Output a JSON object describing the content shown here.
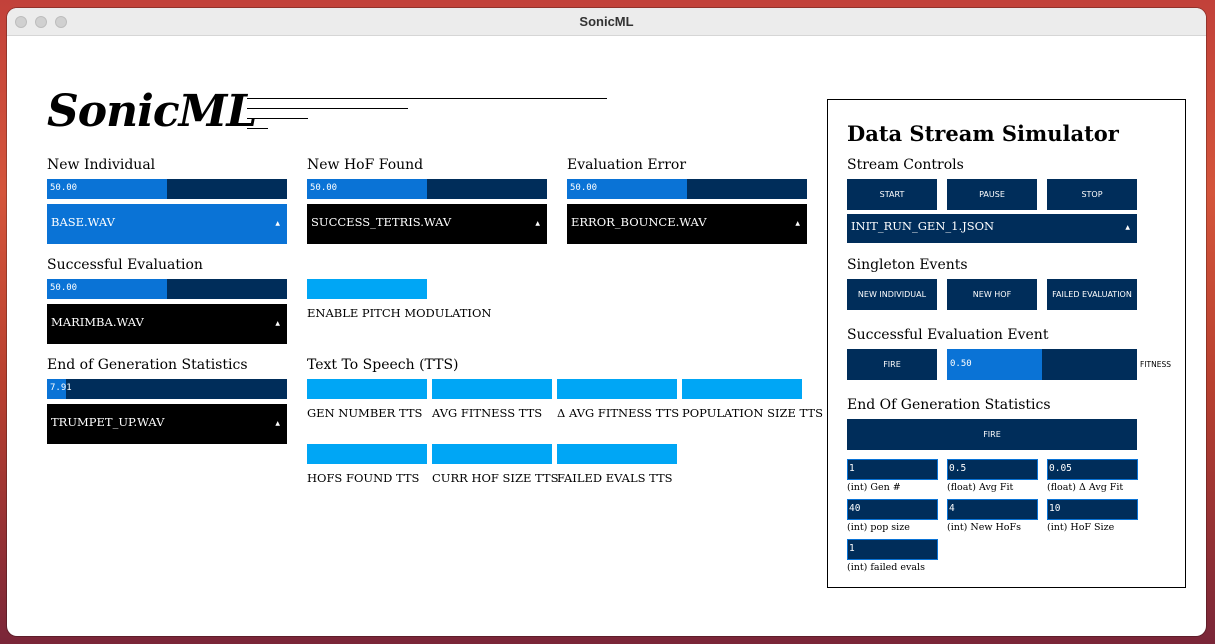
{
  "window": {
    "title": "SonicML"
  },
  "logo": "SonicML",
  "left": {
    "new_individual": {
      "label": "New Individual",
      "volume": "50.00",
      "volume_fraction": 0.5,
      "sound": "BASE.WAV"
    },
    "new_hof": {
      "label": "New HoF Found",
      "volume": "50.00",
      "volume_fraction": 0.5,
      "sound": "SUCCESS_TETRIS.WAV"
    },
    "eval_error": {
      "label": "Evaluation Error",
      "volume": "50.00",
      "volume_fraction": 0.5,
      "sound": "ERROR_BOUNCE.WAV"
    },
    "successful_eval": {
      "label": "Successful Evaluation",
      "volume": "50.00",
      "volume_fraction": 0.5,
      "sound": "MARIMBA.WAV"
    },
    "pitch_modulation": {
      "label": "ENABLE PITCH MODULATION"
    },
    "end_gen": {
      "label": "End of Generation Statistics",
      "volume": "7.91",
      "volume_fraction": 0.08,
      "sound": "TRUMPET_UP.WAV"
    },
    "tts": {
      "label": "Text To Speech (TTS)",
      "toggles": [
        "GEN NUMBER TTS",
        "AVG FITNESS TTS",
        "Δ AVG FITNESS TTS",
        "POPULATION SIZE TTS",
        "HOFS FOUND TTS",
        "CURR HOF SIZE TTS",
        "FAILED EVALS TTS"
      ]
    },
    "dropdown_arrow": "▲"
  },
  "simulator": {
    "title": "Data Stream Simulator",
    "stream_controls": {
      "label": "Stream Controls",
      "start": "START",
      "pause": "PAUSE",
      "stop": "STOP",
      "file": "INIT_RUN_GEN_1.JSON"
    },
    "singleton": {
      "label": "Singleton Events",
      "new_individual": "NEW INDIVIDUAL",
      "new_hof": "NEW HOF",
      "failed_eval": "FAILED EVALUATION"
    },
    "success_event": {
      "label": "Successful Evaluation Event",
      "fire": "FIRE",
      "fitness_value": "0.50",
      "fitness_fraction": 0.5,
      "fitness_label": "FITNESS"
    },
    "end_gen": {
      "label": "End Of Generation Statistics",
      "fire": "FIRE",
      "fields": [
        {
          "value": "1",
          "label": "(int) Gen #"
        },
        {
          "value": "0.5",
          "label": "(float) Avg Fit"
        },
        {
          "value": "0.05",
          "label": "(float) Δ Avg Fit"
        },
        {
          "value": "40",
          "label": "(int) pop size"
        },
        {
          "value": "4",
          "label": "(int) New HoFs"
        },
        {
          "value": "10",
          "label": "(int) HoF Size"
        },
        {
          "value": "1",
          "label": "(int) failed evals"
        }
      ]
    }
  },
  "colors": {
    "navy": "#002d5a",
    "blue": "#0a73d6",
    "cyan": "#00a6f5",
    "black": "#000000"
  }
}
